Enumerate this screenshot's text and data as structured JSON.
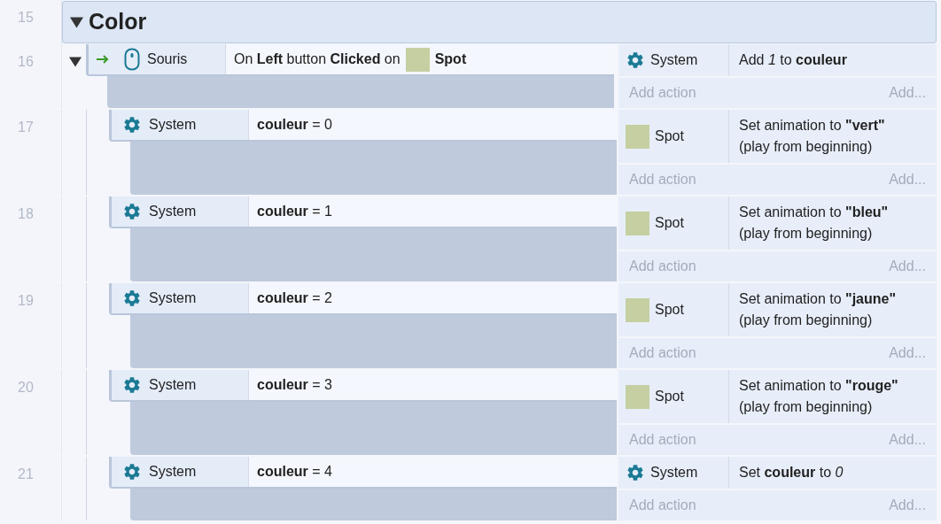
{
  "group": {
    "number": "15",
    "title": "Color",
    "expanded": true
  },
  "events": [
    {
      "number": "16",
      "expanded": true,
      "condition": {
        "trigger": true,
        "kind": "mouse",
        "object": "Souris",
        "text": "On **Left** button **Clicked** on",
        "param_object": "Spot"
      },
      "actions": [
        {
          "kind": "system",
          "object": "System",
          "text": "Add *1* to **couleur**"
        }
      ],
      "add_action": "Add action",
      "add_more": "Add...",
      "children": [
        {
          "number": "17",
          "condition": {
            "trigger": false,
            "kind": "system",
            "object": "System",
            "text": "**couleur** = 0"
          },
          "actions": [
            {
              "kind": "sprite",
              "object": "Spot",
              "text": "Set animation to **\"vert\"**\n(play from beginning)"
            }
          ],
          "add_action": "Add action",
          "add_more": "Add..."
        },
        {
          "number": "18",
          "condition": {
            "trigger": false,
            "kind": "system",
            "object": "System",
            "text": "**couleur** = 1"
          },
          "actions": [
            {
              "kind": "sprite",
              "object": "Spot",
              "text": "Set animation to **\"bleu\"**\n(play from beginning)"
            }
          ],
          "add_action": "Add action",
          "add_more": "Add..."
        },
        {
          "number": "19",
          "condition": {
            "trigger": false,
            "kind": "system",
            "object": "System",
            "text": "**couleur** = 2"
          },
          "actions": [
            {
              "kind": "sprite",
              "object": "Spot",
              "text": "Set animation to **\"jaune\"**\n(play from beginning)"
            }
          ],
          "add_action": "Add action",
          "add_more": "Add..."
        },
        {
          "number": "20",
          "condition": {
            "trigger": false,
            "kind": "system",
            "object": "System",
            "text": "**couleur** = 3"
          },
          "actions": [
            {
              "kind": "sprite",
              "object": "Spot",
              "text": "Set animation to **\"rouge\"**\n(play from beginning)"
            }
          ],
          "add_action": "Add action",
          "add_more": "Add..."
        },
        {
          "number": "21",
          "condition": {
            "trigger": false,
            "kind": "system",
            "object": "System",
            "text": "**couleur** = 4"
          },
          "actions": [
            {
              "kind": "system",
              "object": "System",
              "text": "Set **couleur** to *0*"
            }
          ],
          "add_action": "Add action",
          "add_more": "Add..."
        }
      ]
    }
  ]
}
